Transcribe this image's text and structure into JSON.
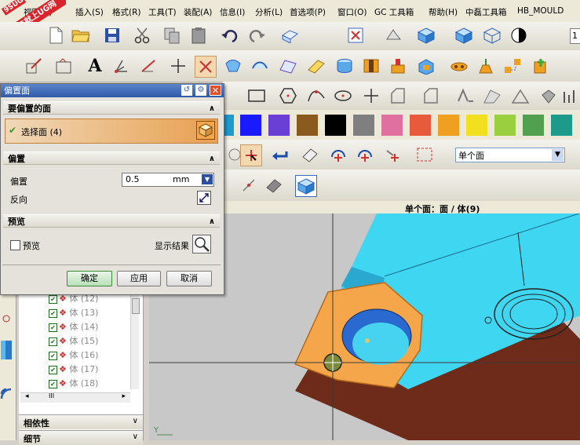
{
  "watermark": {
    "line1": "9SUG",
    "line2": "学UG就上UG网"
  },
  "menu": [
    "视图(V)",
    "插入(S)",
    "格式(R)",
    "工具(T)",
    "装配(A)",
    "信息(I)",
    "分析(L)",
    "首选项(P)",
    "窗口(O)",
    "GC 工具箱",
    "帮助(H)",
    "中磊工具箱",
    "HB_MOULD"
  ],
  "menu_right_value": "1",
  "dialog": {
    "title": "偏置面",
    "section_faces": "要偏置的面",
    "select_face_label": "选择面 (4)",
    "section_offset": "偏置",
    "offset_label": "偏置",
    "offset_value": "0.5",
    "offset_unit": "mm",
    "reverse_label": "反向",
    "section_preview": "预览",
    "preview_label": "预览",
    "show_result_label": "显示结果",
    "ok": "确定",
    "apply": "应用",
    "cancel": "取消"
  },
  "selection_filter": {
    "value": "单个面"
  },
  "status_text": "单个面：面 / 体(9)",
  "navigator": {
    "rows": [
      "体 (12)",
      "体 (13)",
      "体 (14)",
      "体 (15)",
      "体 (16)",
      "体 (17)",
      "体 (18)"
    ],
    "scroll_indicator": "III",
    "panel_dependencies": "相依性",
    "panel_details": "细节"
  },
  "axis_label": "Y",
  "colors": {
    "palette": [
      "#1a1aff",
      "#6a3fd6",
      "#8a5a1f",
      "#000000",
      "#7f7f7f",
      "#e070a0",
      "#e85a3c",
      "#f0a020",
      "#f0e020",
      "#9ad040",
      "#50a050",
      "#1e9a8a"
    ],
    "model_top": "#3fd6f2",
    "model_side": "#6e2b1a",
    "selected_face": "#f5a64a",
    "title_bar": "#2f5aa9"
  }
}
